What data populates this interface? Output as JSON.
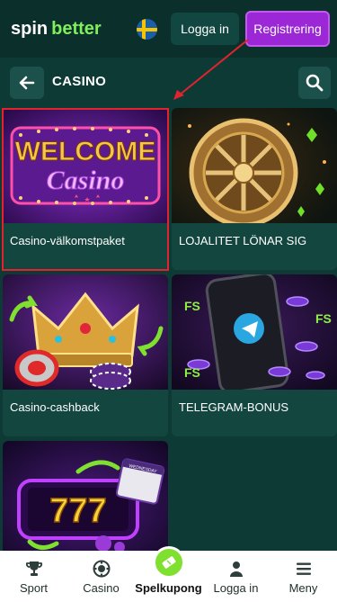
{
  "header": {
    "logo_spin": "spin",
    "logo_better": "better",
    "login_label": "Logga in",
    "register_label": "Registrering"
  },
  "section": {
    "title": "CASINO"
  },
  "cards": [
    {
      "label": "Casino-välkomstpaket",
      "art_text_1": "WELCOME",
      "art_text_2": "Casino"
    },
    {
      "label": "LOJALITET LÖNAR SIG"
    },
    {
      "label": "Casino-cashback"
    },
    {
      "label": "TELEGRAM-BONUS",
      "art_text_1": "FS",
      "art_text_2": "FS",
      "art_text_3": "FS"
    },
    {
      "label": "",
      "art_text_1": "777",
      "art_text_2": "WEDNESDAY"
    }
  ],
  "bottom_nav": [
    {
      "label": "Sport",
      "icon": "trophy-icon"
    },
    {
      "label": "Casino",
      "icon": "chip-icon"
    },
    {
      "label": "Spelkupong",
      "icon": "ticket-icon"
    },
    {
      "label": "Logga in",
      "icon": "user-icon"
    },
    {
      "label": "Meny",
      "icon": "menu-icon"
    }
  ],
  "colors": {
    "background": "#0d3a34",
    "header": "#0b2f2a",
    "brand_green": "#7df05a",
    "register": "#9b27d6",
    "highlight": "#e0232d"
  }
}
